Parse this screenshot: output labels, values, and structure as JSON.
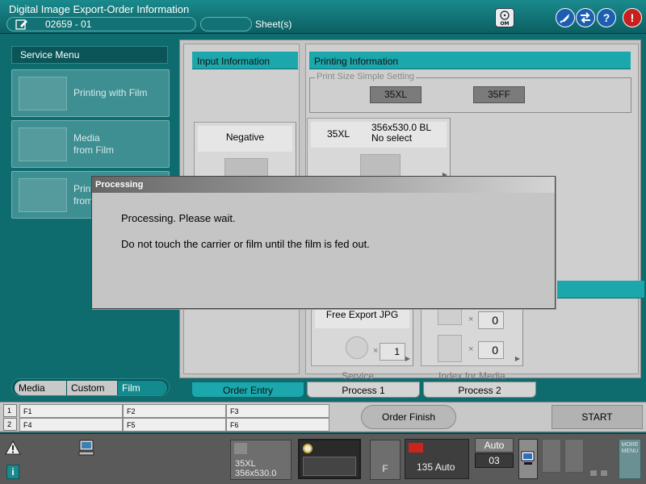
{
  "window": {
    "title": "Digital Image Export-Order Information",
    "order_number": "02659  - 01",
    "sheet_label": "Sheet(s)",
    "dvd_icon_label": "DVD\nOM"
  },
  "colors": {
    "teal_bg": "#0e6b6e",
    "cyan_header": "#1ba7ac",
    "panel_gray": "#c5c5c5",
    "alert_red": "#c8201c",
    "help_blue": "#1c5fb1"
  },
  "icons": {
    "edit": "edit-icon",
    "dvd": "dvd-om-icon",
    "rocket": "rocket-icon",
    "swap": "swap-arrows-icon",
    "help": "help-icon",
    "alert": "alert-icon",
    "warning": "warning-icon",
    "info": "info-icon",
    "pc": "computer-icon"
  },
  "service_menu": {
    "title": "Service Menu",
    "items": [
      {
        "label": "Printing with Film"
      },
      {
        "label": "Media\nfrom Film"
      },
      {
        "label": "Print\nfrom"
      }
    ],
    "mode_tabs": [
      "Media",
      "Custom",
      "Film"
    ],
    "active_mode": "Film"
  },
  "input_info": {
    "header": "Input Information",
    "card_label": "Negative"
  },
  "printing_info": {
    "header": "Printing Information",
    "size_legend": "Print Size Simple Setting",
    "size_buttons": [
      "35XL",
      "35FF"
    ],
    "selected": {
      "size": "35XL",
      "dimension": "356x530.0 BL",
      "select_state": "No select"
    }
  },
  "output": {
    "service_card_label": "Free Export JPG",
    "service_qty": "1",
    "service_caption": "Service",
    "index_qty_a": "0",
    "index_qty_b": "0",
    "index_caption": "Index for Media",
    "times_symbol": "×"
  },
  "process_tabs": [
    "Order Entry",
    "Process 1",
    "Process 2"
  ],
  "active_process_tab": "Order Entry",
  "fkeys": {
    "row_numbers": [
      "1",
      "2"
    ],
    "row1": [
      "F1",
      "F2",
      "F3"
    ],
    "row2": [
      "F4",
      "F5",
      "F6"
    ]
  },
  "actions": {
    "order_finish": "Order Finish",
    "start": "START"
  },
  "status": {
    "film_size": "35XL",
    "film_dimension": "356x530.0",
    "f_label": "F",
    "film_mode": "135 Auto",
    "auto_label": "Auto",
    "counter": "03",
    "more_menu": "MORE\nMENU"
  },
  "dialog": {
    "title": "Processing",
    "message_1": "Processing. Please wait.",
    "message_2": "Do not touch the carrier or film until the film is fed out."
  }
}
